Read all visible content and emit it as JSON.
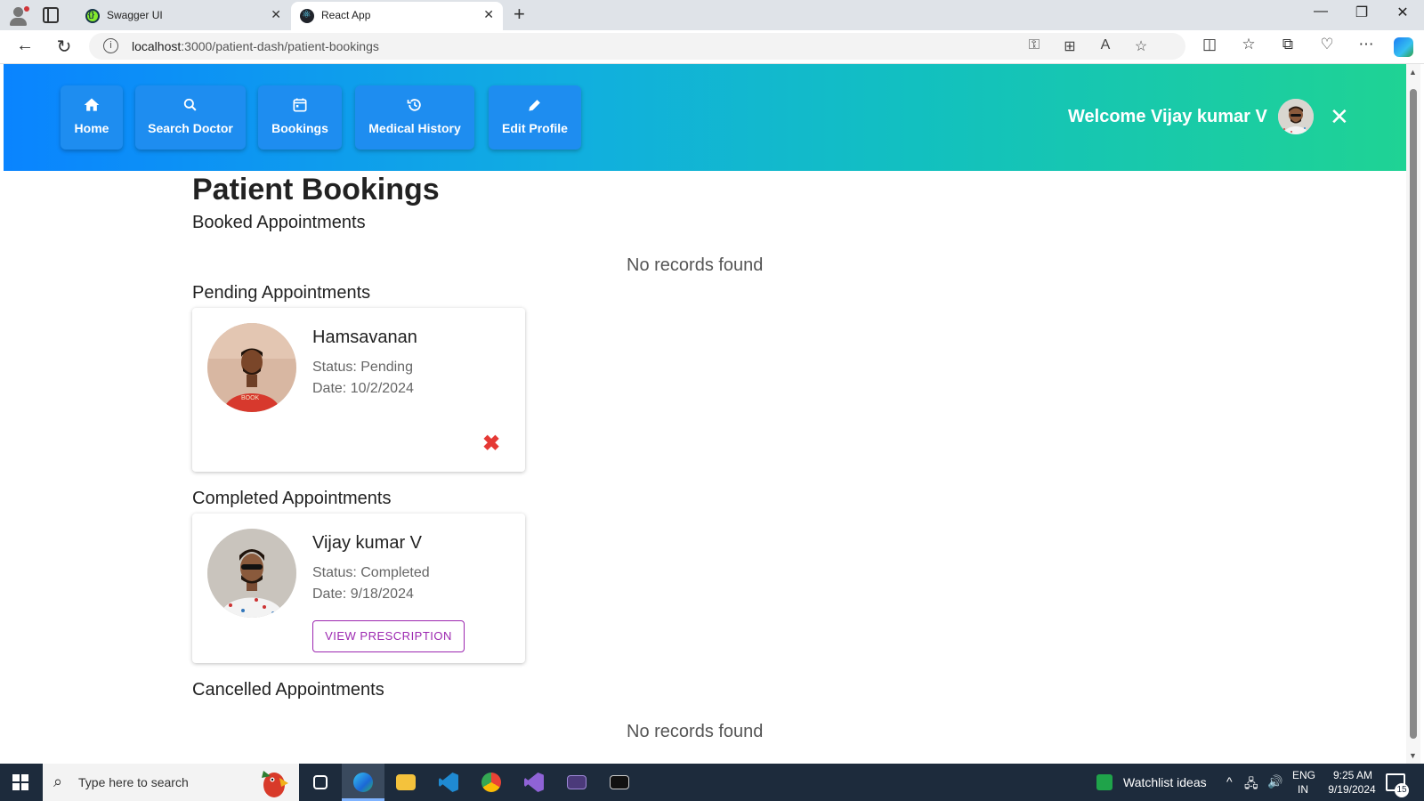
{
  "browser": {
    "tabs": [
      {
        "title": "Swagger UI",
        "active": false,
        "favicon": "swagger-icon"
      },
      {
        "title": "React App",
        "active": true,
        "favicon": "react-icon"
      }
    ],
    "address": {
      "host": "localhost",
      "path": ":3000/patient-dash/patient-bookings"
    }
  },
  "appbar": {
    "nav": [
      {
        "label": "Home",
        "icon": "home-icon"
      },
      {
        "label": "Search Doctor",
        "icon": "search-icon"
      },
      {
        "label": "Bookings",
        "icon": "calendar-icon"
      },
      {
        "label": "Medical History",
        "icon": "history-icon"
      },
      {
        "label": "Edit Profile",
        "icon": "edit-icon"
      }
    ],
    "welcome": "Welcome Vijay kumar V"
  },
  "page": {
    "title": "Patient Bookings",
    "sections": {
      "booked": {
        "title": "Booked Appointments",
        "empty": "No records found"
      },
      "pending": {
        "title": "Pending Appointments",
        "card": {
          "name": "Hamsavanan",
          "status": "Status: Pending",
          "date": "Date: 10/2/2024"
        }
      },
      "completed": {
        "title": "Completed Appointments",
        "card": {
          "name": "Vijay kumar V",
          "status": "Status: Completed",
          "date": "Date: 9/18/2024",
          "action": "VIEW PRESCRIPTION"
        }
      },
      "cancelled": {
        "title": "Cancelled Appointments",
        "empty": "No records found"
      }
    }
  },
  "taskbar": {
    "search_placeholder": "Type here to search",
    "widget": "Watchlist ideas",
    "lang_top": "ENG",
    "lang_bottom": "IN",
    "time": "9:25 AM",
    "date": "9/19/2024",
    "notifications": "15"
  },
  "colors": {
    "appbar_gradient": [
      "#0a84ff",
      "#1fd394"
    ],
    "nav_button": "#1e8df0",
    "cancel_icon": "#e53935",
    "prescription_button": "#9c27b0"
  }
}
